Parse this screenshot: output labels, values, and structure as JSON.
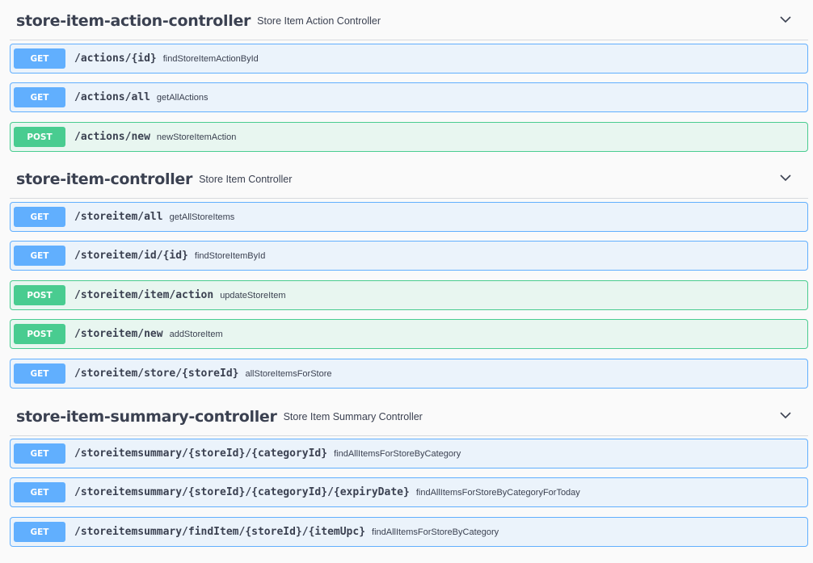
{
  "sections": [
    {
      "title": "store-item-action-controller",
      "description": "Store Item Action Controller",
      "operations": [
        {
          "method": "GET",
          "path": "/actions/{id}",
          "summary": "findStoreItemActionById"
        },
        {
          "method": "GET",
          "path": "/actions/all",
          "summary": "getAllActions"
        },
        {
          "method": "POST",
          "path": "/actions/new",
          "summary": "newStoreItemAction"
        }
      ]
    },
    {
      "title": "store-item-controller",
      "description": "Store Item Controller",
      "operations": [
        {
          "method": "GET",
          "path": "/storeitem/all",
          "summary": "getAllStoreItems"
        },
        {
          "method": "GET",
          "path": "/storeitem/id/{id}",
          "summary": "findStoreItemById"
        },
        {
          "method": "POST",
          "path": "/storeitem/item/action",
          "summary": "updateStoreItem"
        },
        {
          "method": "POST",
          "path": "/storeitem/new",
          "summary": "addStoreItem"
        },
        {
          "method": "GET",
          "path": "/storeitem/store/{storeId}",
          "summary": "allStoreItemsForStore"
        }
      ]
    },
    {
      "title": "store-item-summary-controller",
      "description": "Store Item Summary Controller",
      "operations": [
        {
          "method": "GET",
          "path": "/storeitemsummary/{storeId}/{categoryId}",
          "summary": "findAllItemsForStoreByCategory"
        },
        {
          "method": "GET",
          "path": "/storeitemsummary/{storeId}/{categoryId}/{expiryDate}",
          "summary": "findAllItemsForStoreByCategoryForToday"
        },
        {
          "method": "GET",
          "path": "/storeitemsummary/findItem/{storeId}/{itemUpc}",
          "summary": "findAllItemsForStoreByCategory"
        }
      ]
    }
  ],
  "icons": {
    "collapse": "chevron-down-icon"
  },
  "colors": {
    "get_accent": "#61affe",
    "get_bg": "#ebf3fb",
    "post_accent": "#49cc90",
    "post_bg": "#e8f6f0",
    "text": "#3b4151"
  }
}
